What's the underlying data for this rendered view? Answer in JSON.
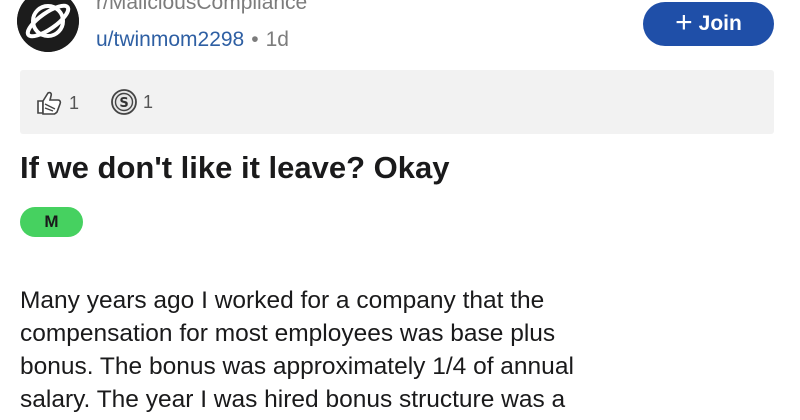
{
  "header": {
    "subreddit": "r/MaliciousCompliance",
    "username": "u/twinmom2298",
    "separator": "•",
    "age": "1d",
    "join_label": "Join",
    "join_icon": "plus-icon",
    "avatar_icon": "planet-icon"
  },
  "awards": [
    {
      "icon": "thumbs-up-award-icon",
      "count": "1"
    },
    {
      "icon": "silver-coin-award-icon",
      "count": "1"
    }
  ],
  "post": {
    "title": "If we don't like it leave? Okay",
    "flair": "M",
    "body_lines": [
      "Many years ago I worked for a company that the",
      "compensation for most employees was base plus",
      "bonus.  The bonus was approximately 1/4 of annual",
      "salary. The year I was hired bonus structure was a"
    ]
  },
  "colors": {
    "join_button": "#1f4fa8",
    "username_link": "#2e5fa3",
    "flair_green": "#46d160",
    "awards_bar_bg": "#f2f2f2"
  }
}
